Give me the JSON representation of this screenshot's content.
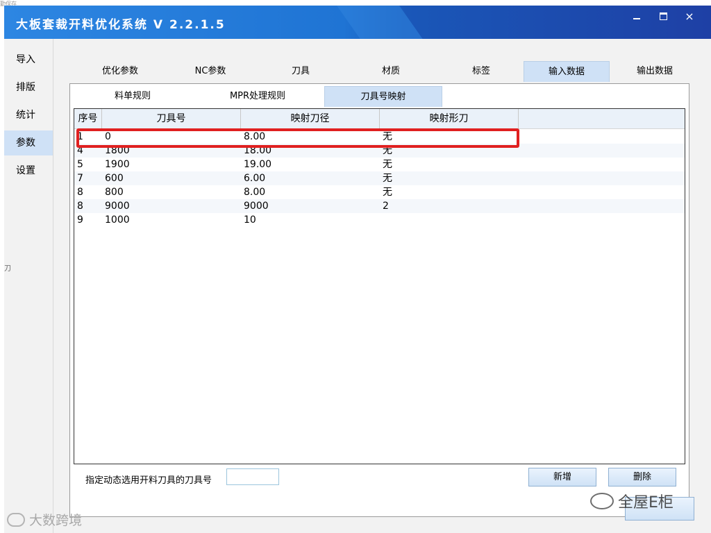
{
  "window": {
    "title": "大板套裁开料优化系统 V 2.2.1.5",
    "controls": {
      "minimize": "minimize",
      "maximize": "maximize",
      "close": "×"
    }
  },
  "sidebar": {
    "items": [
      {
        "label": "导入"
      },
      {
        "label": "排版"
      },
      {
        "label": "统计"
      },
      {
        "label": "参数",
        "active": true
      },
      {
        "label": "设置"
      }
    ]
  },
  "tabs": [
    {
      "label": "优化参数"
    },
    {
      "label": "NC参数"
    },
    {
      "label": "刀具"
    },
    {
      "label": "材质"
    },
    {
      "label": "标签"
    },
    {
      "label": "输入数据",
      "active": true
    },
    {
      "label": "输出数据"
    }
  ],
  "subtabs": [
    {
      "label": "料单规则"
    },
    {
      "label": "MPR处理规则"
    },
    {
      "label": "刀具号映射",
      "active": true
    }
  ],
  "table": {
    "headers": [
      "序号",
      "刀具号",
      "映射刀径",
      "映射形刀"
    ],
    "rows": [
      [
        "1",
        "0",
        "8.00",
        "无"
      ],
      [
        "4",
        "1800",
        "18.00",
        "无"
      ],
      [
        "5",
        "1900",
        "19.00",
        "无"
      ],
      [
        "7",
        "600",
        "6.00",
        "无"
      ],
      [
        "8",
        "800",
        "8.00",
        "无"
      ],
      [
        "8",
        "9000",
        "9000",
        "2"
      ],
      [
        "9",
        "1000",
        "10",
        ""
      ]
    ],
    "highlight_color": "#e02020"
  },
  "footer": {
    "label": "指定动态选用开料刀具的刀具号",
    "input_value": "",
    "add_button": "新增",
    "delete_button": "删除"
  },
  "watermarks": {
    "right": "全屋E柜",
    "left": "大数跨境"
  },
  "colors": {
    "title_gradient_start": "#2d86e2",
    "title_gradient_end": "#1e40a5",
    "active_tab": "#cfe1f6"
  }
}
